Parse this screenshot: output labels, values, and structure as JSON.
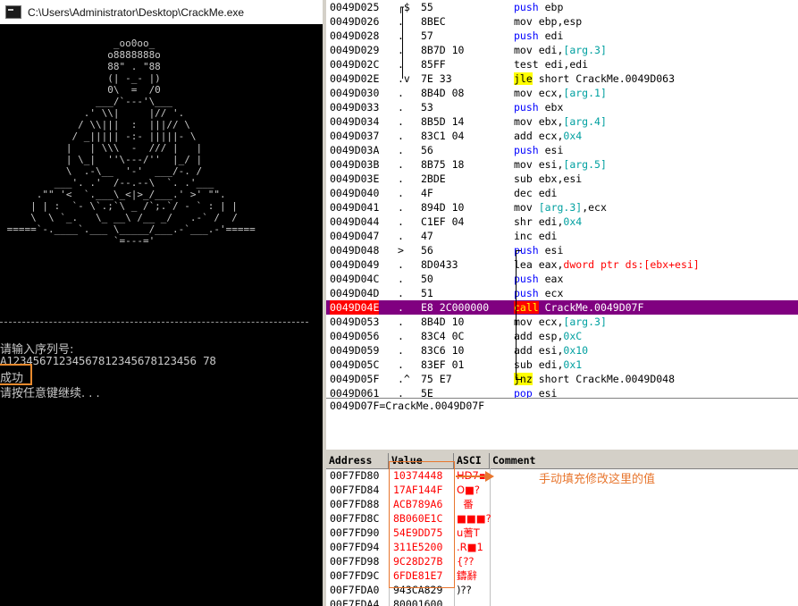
{
  "console": {
    "title": "C:\\Users\\Administrator\\Desktop\\CrackMe.exe",
    "ascii_art": "                   _oo0oo_\n                  o8888888o\n                  88\" . \"88\n                  (| -_- |)\n                  0\\  =  /0\n                ___/`---'\\___\n              .' \\\\|     |// '.\n             / \\\\|||  :  |||// \\\n            / _||||| -:- |||||- \\\n           |   | \\\\\\  -  /// |   |\n           | \\_|  ''\\---/''  |_/ |\n           \\  .-\\__  '-'  ___/-. /\n         ___'. .'  /--.--\\  `. .'___\n      .\"\" '<  `.___\\_<|>_/___.' >' \"\".\n     | | :  `- \\`.;`\\ _ /`;.`/ - ` : | |\n     \\  \\ `_.   \\_ __\\ /__ _/   .-` /  /\n =====`-.____`.___ \\_____/___.-`___.-'=====\n                   `=---='",
    "prompt": "请输入序列号:",
    "serial": "A12345671234567812345678123456 78",
    "result": "成功",
    "continue_msg": "请按任意键继续. . ."
  },
  "disassembly": {
    "rows": [
      {
        "addr": "0049D025",
        "mark": "┌$",
        "hex": "55",
        "parts": [
          [
            "push",
            "kw-blue"
          ],
          [
            " ebp",
            ""
          ]
        ]
      },
      {
        "addr": "0049D026",
        "mark": ".",
        "hex": "8BEC",
        "parts": [
          [
            "mov",
            ""
          ],
          [
            " ebp,esp",
            ""
          ]
        ]
      },
      {
        "addr": "0049D028",
        "mark": ".",
        "hex": "57",
        "parts": [
          [
            "push",
            "kw-blue"
          ],
          [
            " edi",
            ""
          ]
        ]
      },
      {
        "addr": "0049D029",
        "mark": ".",
        "hex": "8B7D 10",
        "parts": [
          [
            "mov",
            ""
          ],
          [
            " edi,",
            ""
          ],
          [
            "[arg.3]",
            "kw-teal"
          ]
        ]
      },
      {
        "addr": "0049D02C",
        "mark": ".",
        "hex": "85FF",
        "parts": [
          [
            "test",
            ""
          ],
          [
            " edi,edi",
            ""
          ]
        ]
      },
      {
        "addr": "0049D02E",
        "mark": ".v",
        "hex": "7E 33",
        "parts": [
          [
            "jle",
            "hl-yellow"
          ],
          [
            " short CrackMe.0049D063",
            ""
          ]
        ]
      },
      {
        "addr": "0049D030",
        "mark": ".",
        "hex": "8B4D 08",
        "parts": [
          [
            "mov",
            ""
          ],
          [
            " ecx,",
            ""
          ],
          [
            "[arg.1]",
            "kw-teal"
          ]
        ]
      },
      {
        "addr": "0049D033",
        "mark": ".",
        "hex": "53",
        "parts": [
          [
            "push",
            "kw-blue"
          ],
          [
            " ebx",
            ""
          ]
        ]
      },
      {
        "addr": "0049D034",
        "mark": ".",
        "hex": "8B5D 14",
        "parts": [
          [
            "mov",
            ""
          ],
          [
            " ebx,",
            ""
          ],
          [
            "[arg.4]",
            "kw-teal"
          ]
        ]
      },
      {
        "addr": "0049D037",
        "mark": ".",
        "hex": "83C1 04",
        "parts": [
          [
            "add",
            ""
          ],
          [
            " ecx,",
            ""
          ],
          [
            "0x4",
            "kw-teal"
          ]
        ]
      },
      {
        "addr": "0049D03A",
        "mark": ".",
        "hex": "56",
        "parts": [
          [
            "push",
            "kw-blue"
          ],
          [
            " esi",
            ""
          ]
        ]
      },
      {
        "addr": "0049D03B",
        "mark": ".",
        "hex": "8B75 18",
        "parts": [
          [
            "mov",
            ""
          ],
          [
            " esi,",
            ""
          ],
          [
            "[arg.5]",
            "kw-teal"
          ]
        ]
      },
      {
        "addr": "0049D03E",
        "mark": ".",
        "hex": "2BDE",
        "parts": [
          [
            "sub",
            ""
          ],
          [
            " ebx,esi",
            ""
          ]
        ]
      },
      {
        "addr": "0049D040",
        "mark": ".",
        "hex": "4F",
        "parts": [
          [
            "dec",
            ""
          ],
          [
            " edi",
            ""
          ]
        ]
      },
      {
        "addr": "0049D041",
        "mark": ".",
        "hex": "894D 10",
        "parts": [
          [
            "mov",
            ""
          ],
          [
            " ",
            ""
          ],
          [
            "[arg.3]",
            "kw-teal"
          ],
          [
            ",ecx",
            ""
          ]
        ]
      },
      {
        "addr": "0049D044",
        "mark": ".",
        "hex": "C1EF 04",
        "parts": [
          [
            "shr",
            ""
          ],
          [
            " edi,",
            ""
          ],
          [
            "0x4",
            "kw-teal"
          ]
        ]
      },
      {
        "addr": "0049D047",
        "mark": ".",
        "hex": "47",
        "parts": [
          [
            "inc",
            ""
          ],
          [
            " edi",
            ""
          ]
        ]
      },
      {
        "addr": "0049D048",
        "mark": ">",
        "hex": "56",
        "parts": [
          [
            "push",
            "kw-blue"
          ],
          [
            " esi",
            ""
          ]
        ]
      },
      {
        "addr": "0049D049",
        "mark": ".",
        "hex": "8D0433",
        "parts": [
          [
            "lea",
            ""
          ],
          [
            " eax,",
            ""
          ],
          [
            "dword ptr ds:[ebx+esi]",
            "kw-red"
          ]
        ]
      },
      {
        "addr": "0049D04C",
        "mark": ".",
        "hex": "50",
        "parts": [
          [
            "push",
            "kw-blue"
          ],
          [
            " eax",
            ""
          ]
        ]
      },
      {
        "addr": "0049D04D",
        "mark": ".",
        "hex": "51",
        "parts": [
          [
            "push",
            "kw-blue"
          ],
          [
            " ecx",
            ""
          ]
        ]
      },
      {
        "addr": "0049D04E",
        "mark": ".",
        "hex": "E8 2C000000",
        "parts": [
          [
            "call",
            "hl-red"
          ],
          [
            " CrackMe.0049D07F",
            ""
          ]
        ],
        "selected": true
      },
      {
        "addr": "0049D053",
        "mark": ".",
        "hex": "8B4D 10",
        "parts": [
          [
            "mov",
            ""
          ],
          [
            " ecx,",
            ""
          ],
          [
            "[arg.3]",
            "kw-teal"
          ]
        ]
      },
      {
        "addr": "0049D056",
        "mark": ".",
        "hex": "83C4 0C",
        "parts": [
          [
            "add",
            ""
          ],
          [
            " esp,",
            ""
          ],
          [
            "0xC",
            "kw-teal"
          ]
        ]
      },
      {
        "addr": "0049D059",
        "mark": ".",
        "hex": "83C6 10",
        "parts": [
          [
            "add",
            ""
          ],
          [
            " esi,",
            ""
          ],
          [
            "0x10",
            "kw-teal"
          ]
        ]
      },
      {
        "addr": "0049D05C",
        "mark": ".",
        "hex": "83EF 01",
        "parts": [
          [
            "sub",
            ""
          ],
          [
            " edi,",
            ""
          ],
          [
            "0x1",
            "kw-teal"
          ]
        ]
      },
      {
        "addr": "0049D05F",
        "mark": ".^",
        "hex": "75 E7",
        "parts": [
          [
            "jnz",
            "hl-yellow"
          ],
          [
            " short CrackMe.0049D048",
            ""
          ]
        ]
      },
      {
        "addr": "0049D061",
        "mark": ".",
        "hex": "5E",
        "parts": [
          [
            "pop",
            "kw-blue"
          ],
          [
            " esi",
            ""
          ]
        ]
      }
    ]
  },
  "info": {
    "text": "0049D07F=CrackMe.0049D07F"
  },
  "stack": {
    "headers": [
      "Address",
      "Value",
      "ASCI",
      "Comment"
    ],
    "rows": [
      {
        "addr": "00F7FD80",
        "value": "10374448",
        "ascii": "HD7▪",
        "hl": true
      },
      {
        "addr": "00F7FD84",
        "value": "17AF144F",
        "ascii": "O■?",
        "hl": true
      },
      {
        "addr": "00F7FD88",
        "value": "ACB789A6",
        "ascii": "  番",
        "hl": true
      },
      {
        "addr": "00F7FD8C",
        "value": "8B060E1C",
        "ascii": "■■■?",
        "hl": true
      },
      {
        "addr": "00F7FD90",
        "value": "54E9DD75",
        "ascii": "u蓍T",
        "hl": true
      },
      {
        "addr": "00F7FD94",
        "value": "311E5200",
        "ascii": ".R■1",
        "hl": true
      },
      {
        "addr": "00F7FD98",
        "value": "9C28D27B",
        "ascii": "{??",
        "hl": true
      },
      {
        "addr": "00F7FD9C",
        "value": "6FDE81E7",
        "ascii": "鑄辭",
        "hl": true
      },
      {
        "addr": "00F7FDA0",
        "value": "943CA829",
        "ascii": ")??",
        "hl": false
      },
      {
        "addr": "00F7FDA4",
        "value": "80001600",
        "ascii": "",
        "hl": false
      }
    ]
  },
  "annotation": {
    "text": "手动填充修改这里的值",
    "color": "#e8762e"
  }
}
